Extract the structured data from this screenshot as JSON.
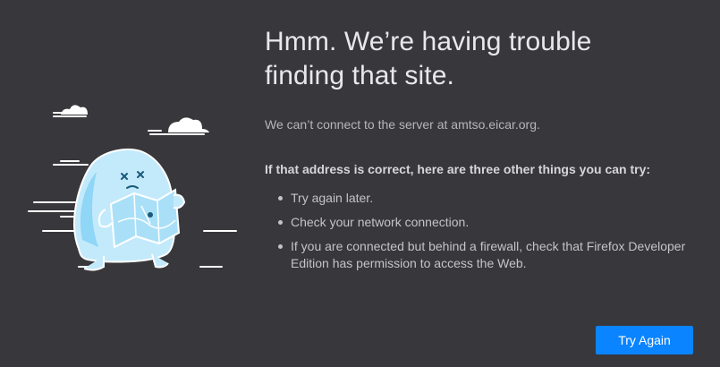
{
  "error": {
    "title_line1": "Hmm. We’re having trouble",
    "title_line2": "finding that site.",
    "intro": "We can’t connect to the server at amtso.eicar.org.",
    "tips_heading": "If that address is correct, here are three other things you can try:",
    "tips": [
      "Try again later.",
      "Check your network connection.",
      "If you are connected but behind a firewall, check that Firefox Developer Edition has permission to access the Web."
    ]
  },
  "actions": {
    "try_again_label": "Try Again"
  },
  "colors": {
    "background": "#38373c",
    "accent": "#0a84ff",
    "illustration_blue": "#8fd6f7"
  },
  "icons": {
    "illustration": "lost-monster-with-map-illustration"
  }
}
